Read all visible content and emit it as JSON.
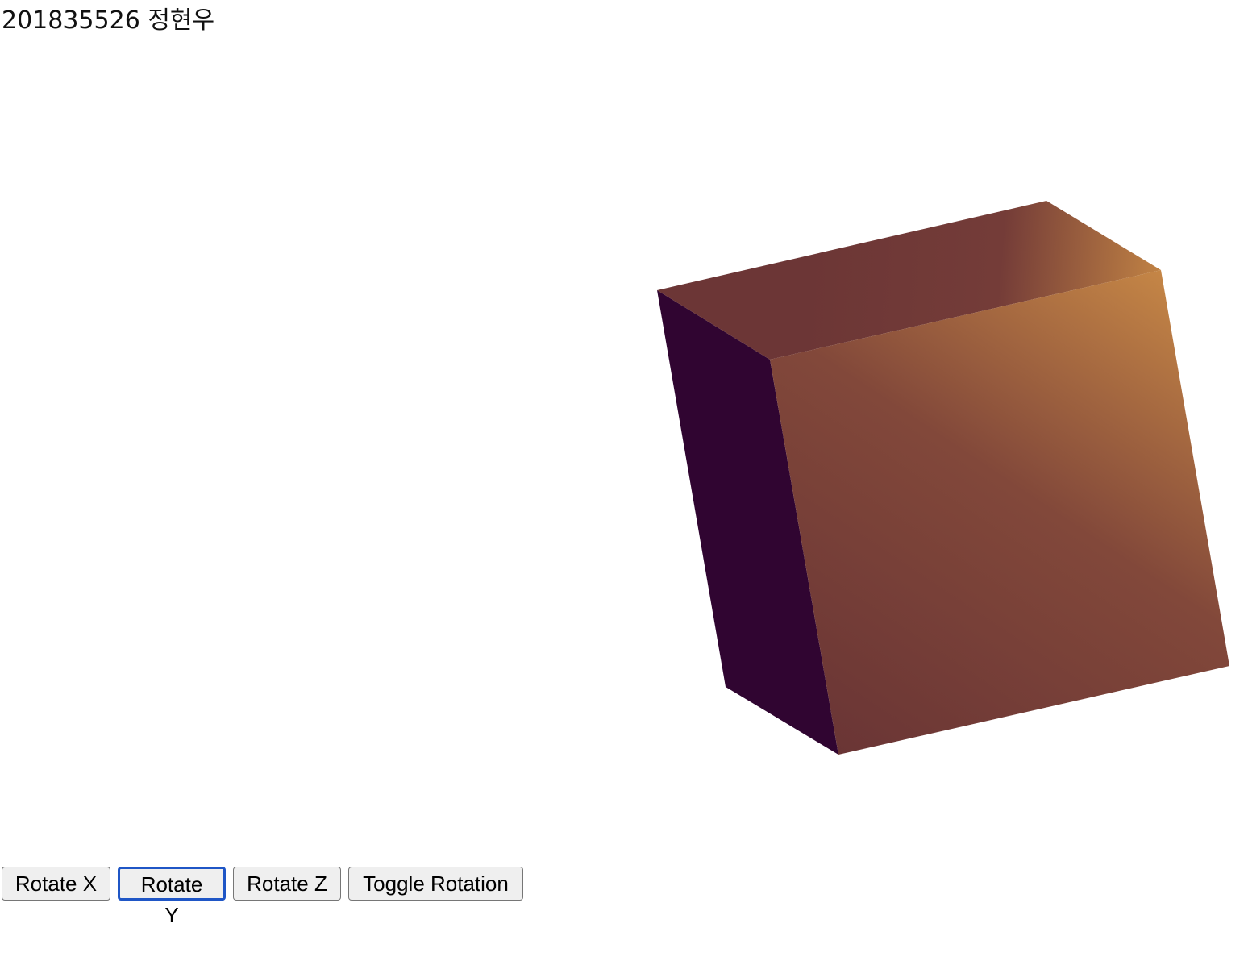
{
  "header": {
    "student_label": "201835526 정현우"
  },
  "scene": {
    "object": "cube",
    "colors": {
      "left_face": "#300531",
      "front_face_dark": "#6a3535",
      "front_face_mid": "#82483a",
      "front_face_light": "#c58646",
      "top_face_dark": "#6c3636",
      "top_face_light": "#c08244"
    }
  },
  "controls": {
    "rotate_x_label": "Rotate X",
    "rotate_y_label": "Rotate Y",
    "rotate_z_label": "Rotate Z",
    "toggle_label": "Toggle Rotation",
    "focused": "Rotate Y"
  }
}
